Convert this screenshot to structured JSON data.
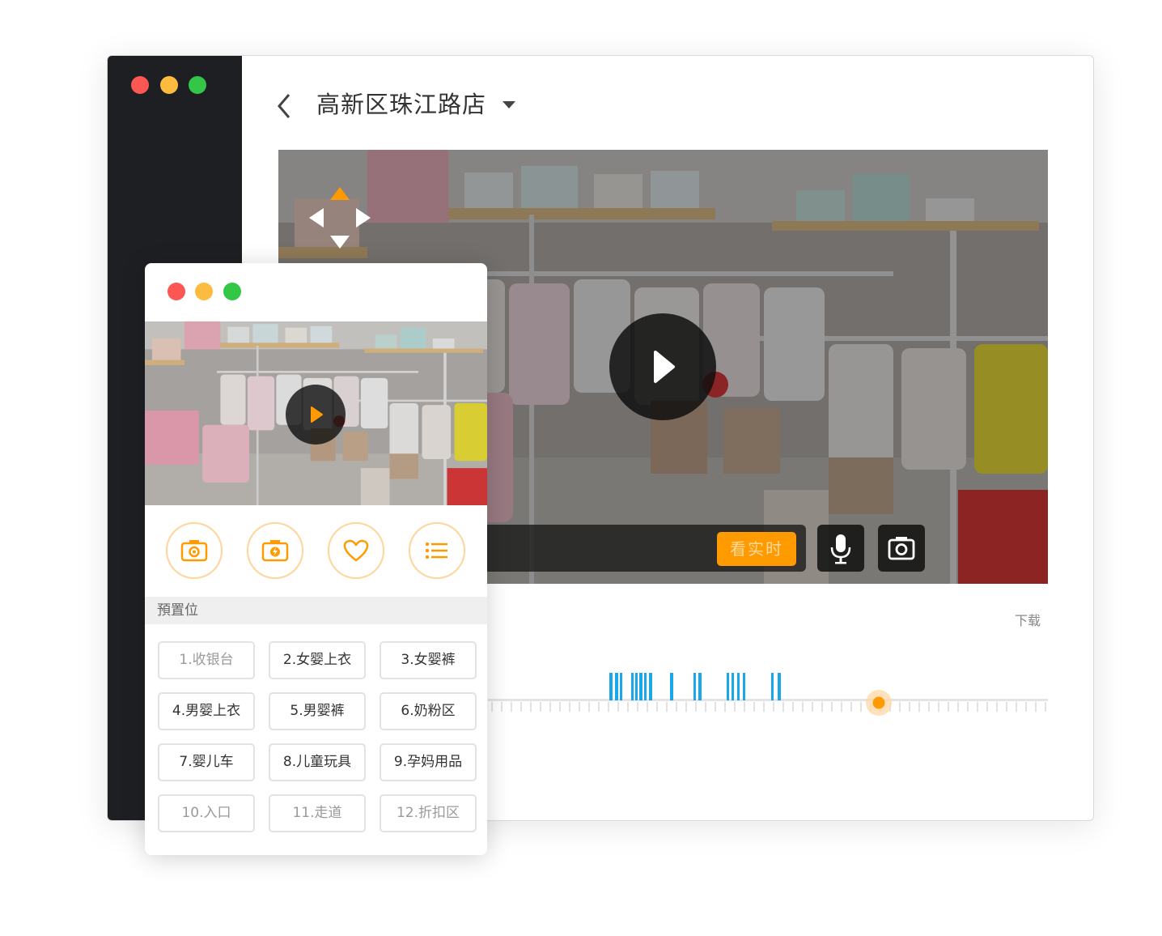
{
  "main_window": {
    "store_name": "高新区珠江路店",
    "live_button_label": "看实时",
    "download_label": "下载"
  },
  "popup": {
    "preset_header": "預置位",
    "presets": [
      {
        "label": "1.收银台"
      },
      {
        "label": "2.女婴上衣"
      },
      {
        "label": "3.女婴裤"
      },
      {
        "label": "4.男婴上衣"
      },
      {
        "label": "5.男婴裤"
      },
      {
        "label": "6.奶粉区"
      },
      {
        "label": "7.婴儿车"
      },
      {
        "label": "8.儿童玩具"
      },
      {
        "label": "9.孕妈用品"
      },
      {
        "label": "10.入口"
      },
      {
        "label": "11.走道"
      },
      {
        "label": "12.折扣区"
      }
    ],
    "actions": [
      {
        "icon": "camera-icon"
      },
      {
        "icon": "camera-flash-icon"
      },
      {
        "icon": "heart-icon"
      },
      {
        "icon": "list-icon"
      }
    ]
  },
  "colors": {
    "accent_orange": "#ff9a00",
    "recording_blue": "#1aa7e8",
    "sidebar_dark": "#1e1f22"
  }
}
